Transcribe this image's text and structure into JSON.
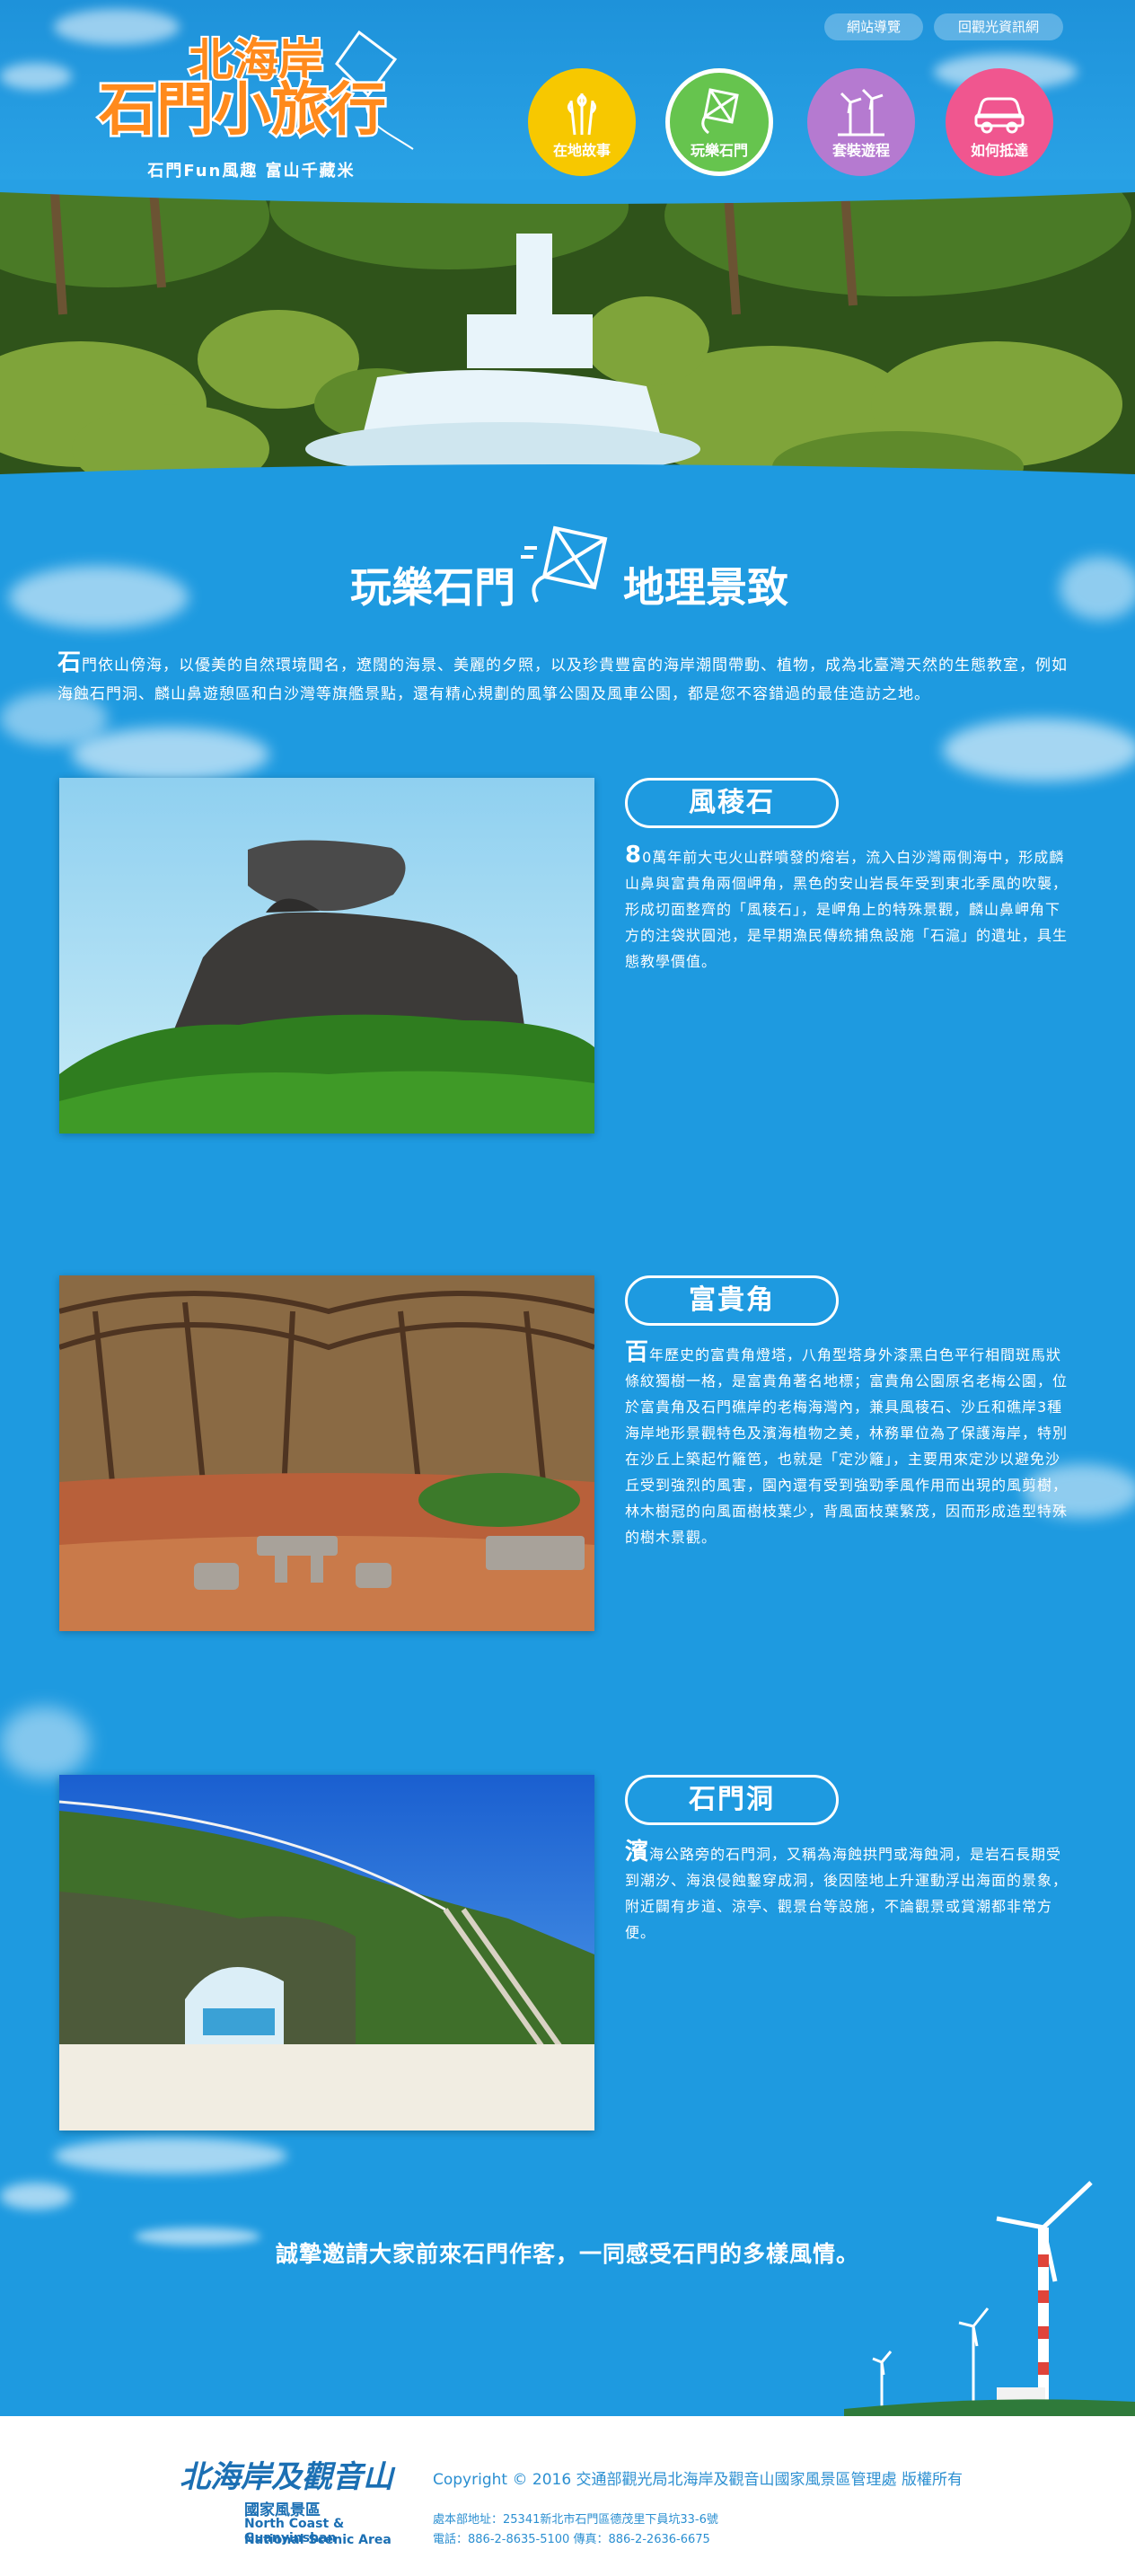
{
  "header": {
    "logo_title_line1": "北海岸",
    "logo_title_line2": "石門小旅行",
    "logo_subtitle": "石門Fun風趣 富山千藏米",
    "top_links": [
      "網站導覽",
      "回觀光資訊網"
    ],
    "nav": [
      {
        "label": "在地故事",
        "icon": "wheat-icon",
        "color": "#f7c800"
      },
      {
        "label": "玩樂石門",
        "icon": "kite-icon",
        "color": "#66c44e"
      },
      {
        "label": "套裝遊程",
        "icon": "windmill-icon",
        "color": "#b57ad0"
      },
      {
        "label": "如何抵達",
        "icon": "car-icon",
        "color": "#f0568f"
      }
    ]
  },
  "section": {
    "title_left": "玩樂石門",
    "title_right": "地理景致",
    "intro_dropcap": "石",
    "intro": "門依山傍海，以優美的自然環境聞名，遼闊的海景、美麗的夕照，以及珍貴豐富的海岸潮間帶動、植物，成為北臺灣天然的生態教室，例如海蝕石門洞、麟山鼻遊憩區和白沙灣等旗艦景點，還有精心規劃的風箏公園及風車公園，都是您不容錯過的最佳造訪之地。"
  },
  "attractions": [
    {
      "title": "風稜石",
      "dropcap": "8",
      "text": "0萬年前大屯火山群噴發的熔岩，流入白沙灣兩側海中，形成麟山鼻與富貴角兩個岬角，黑色的安山岩長年受到東北季風的吹襲，形成切面整齊的「風稜石」，是岬角上的特殊景觀，麟山鼻岬角下方的注袋狀圓池，是早期漁民傳統捕魚設施「石滬」的遺址，具生態教學價值。"
    },
    {
      "title": "富貴角",
      "dropcap": "百",
      "text": "年歷史的富貴角燈塔，八角型塔身外漆黑白色平行相間斑馬狀條紋獨樹一格，是富貴角著名地標；富貴角公園原名老梅公園，位於富貴角及石門礁岸的老梅海灣內，兼具風稜石、沙丘和礁岸3種海岸地形景觀特色及濱海植物之美，林務單位為了保護海岸，特別在沙丘上築起竹籬笆，也就是「定沙籬」，主要用來定沙以避免沙丘受到強烈的風害，園內還有受到強勁季風作用而出現的風剪樹，林木樹冠的向風面樹枝葉少，背風面枝葉繁茂，因而形成造型特殊的樹木景觀。"
    },
    {
      "title": "石門洞",
      "dropcap": "濱",
      "text": "海公路旁的石門洞，又稱為海蝕拱門或海蝕洞，是岩石長期受到潮汐、海浪侵蝕鑿穿成洞，後因陸地上升運動浮出海面的景象，附近闢有步道、涼亭、觀景台等設施，不論觀景或賞潮都非常方便。"
    }
  ],
  "closing": "誠摯邀請大家前來石門作客，一同感受石門的多樣風情。",
  "footer": {
    "logo_script": "北海岸及觀音山",
    "logo_zh": "國家風景區",
    "logo_en1": "North Coast & Guanyinshan",
    "logo_en2": "National Scenic Area",
    "copyright": "Copyright © 2016 交通部觀光局北海岸及觀音山國家風景區管理處 版權所有",
    "address": "處本部地址：25341新北市石門區德茂里下員坑33-6號",
    "tel": "電話：886-2-8635-5100 傳真：886-2-2636-6675"
  },
  "colors": {
    "background": "#1e9ae0",
    "accent_white": "#ffffff",
    "footer_text": "#2b8fd1"
  }
}
